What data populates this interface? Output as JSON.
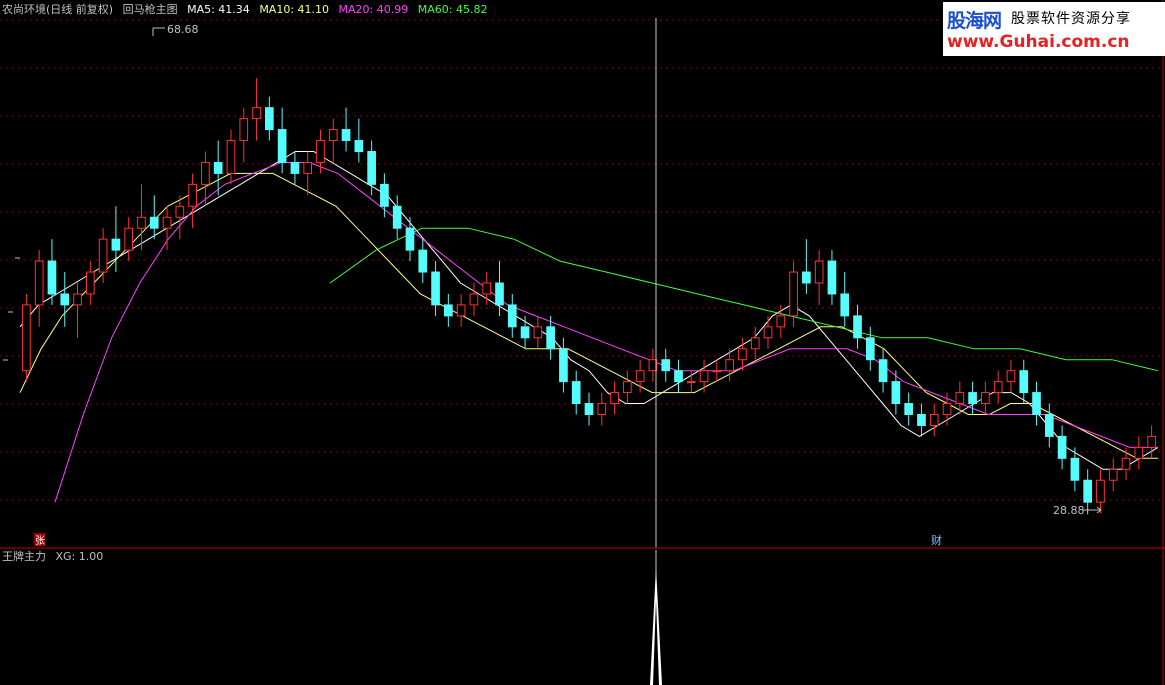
{
  "header": {
    "stock_name": "农尚环境(日线 前复权)",
    "formula_name": "回马枪主图",
    "ma5": "MA5: 41.34",
    "ma10": "MA10: 41.10",
    "ma20": "MA20: 40.99",
    "ma60": "MA60: 45.82",
    "colors": {
      "title": "#c0c0c0",
      "ma5": "#ffffff",
      "ma10": "#ffff80",
      "ma20": "#ff40ff",
      "ma60": "#40ff40"
    }
  },
  "logo": {
    "brand": "股海网",
    "slogan": "股票软件资源分享",
    "url": "www.Guhai.com.cn"
  },
  "indicator": {
    "name": "王牌主力",
    "value": "XG: 1.00"
  },
  "markers": {
    "high_label": "68.68",
    "low_label": "28.88",
    "badge_zhang": "张",
    "badge_cai": "财"
  },
  "chart_data": {
    "type": "candlestick",
    "price_range": [
      26,
      74
    ],
    "candles_ohlc": [
      [
        42,
        49,
        41,
        48
      ],
      [
        48,
        53,
        46,
        52
      ],
      [
        52,
        54,
        48,
        49
      ],
      [
        49,
        51,
        46,
        48
      ],
      [
        48,
        50,
        45,
        49
      ],
      [
        49,
        52,
        48,
        51
      ],
      [
        51,
        55,
        50,
        54
      ],
      [
        54,
        57,
        51,
        53
      ],
      [
        53,
        56,
        52,
        55
      ],
      [
        55,
        59,
        53,
        56
      ],
      [
        56,
        58,
        54,
        55
      ],
      [
        55,
        57,
        53,
        56
      ],
      [
        56,
        58,
        54,
        57
      ],
      [
        57,
        60,
        55,
        59
      ],
      [
        59,
        62,
        57,
        61
      ],
      [
        61,
        63,
        58,
        60
      ],
      [
        60,
        64,
        59,
        63
      ],
      [
        63,
        66,
        61,
        65
      ],
      [
        65,
        68.68,
        63,
        66
      ],
      [
        66,
        67,
        63,
        64
      ],
      [
        64,
        66,
        60,
        61
      ],
      [
        61,
        62,
        59,
        60
      ],
      [
        60,
        62,
        58,
        61
      ],
      [
        61,
        64,
        60,
        63
      ],
      [
        63,
        65,
        61,
        64
      ],
      [
        64,
        66,
        62,
        63
      ],
      [
        63,
        65,
        61,
        62
      ],
      [
        62,
        63,
        58,
        59
      ],
      [
        59,
        60,
        56,
        57
      ],
      [
        57,
        58,
        54,
        55
      ],
      [
        55,
        56,
        52,
        53
      ],
      [
        53,
        54,
        50,
        51
      ],
      [
        51,
        52,
        47,
        48
      ],
      [
        48,
        49,
        46,
        47
      ],
      [
        47,
        49,
        46,
        48
      ],
      [
        48,
        50,
        47,
        49
      ],
      [
        49,
        51,
        48,
        50
      ],
      [
        50,
        52,
        47,
        48
      ],
      [
        48,
        49,
        45,
        46
      ],
      [
        46,
        47,
        44,
        45
      ],
      [
        45,
        47,
        44,
        46
      ],
      [
        46,
        47,
        43,
        44
      ],
      [
        44,
        45,
        40,
        41
      ],
      [
        41,
        42,
        38,
        39
      ],
      [
        39,
        40,
        37,
        38
      ],
      [
        38,
        40,
        37,
        39
      ],
      [
        39,
        41,
        38,
        40
      ],
      [
        40,
        42,
        39,
        41
      ],
      [
        41,
        43,
        40,
        42
      ],
      [
        42,
        44,
        41,
        43
      ],
      [
        43,
        44,
        41,
        42
      ],
      [
        42,
        43,
        40,
        41
      ],
      [
        41,
        42,
        40,
        41
      ],
      [
        41,
        43,
        40,
        42
      ],
      [
        42,
        43,
        41,
        42
      ],
      [
        42,
        44,
        41,
        43
      ],
      [
        43,
        45,
        42,
        44
      ],
      [
        44,
        46,
        43,
        45
      ],
      [
        45,
        47,
        44,
        46
      ],
      [
        46,
        48,
        45,
        47
      ],
      [
        47,
        52,
        46,
        51
      ],
      [
        51,
        54,
        49,
        50
      ],
      [
        50,
        53,
        48,
        52
      ],
      [
        52,
        53,
        48,
        49
      ],
      [
        49,
        51,
        46,
        47
      ],
      [
        47,
        48,
        44,
        45
      ],
      [
        45,
        46,
        42,
        43
      ],
      [
        43,
        44,
        40,
        41
      ],
      [
        41,
        42,
        38,
        39
      ],
      [
        39,
        40,
        37,
        38
      ],
      [
        38,
        39,
        36,
        37
      ],
      [
        37,
        39,
        36,
        38
      ],
      [
        38,
        40,
        37,
        39
      ],
      [
        39,
        41,
        38,
        40
      ],
      [
        40,
        41,
        38,
        39
      ],
      [
        39,
        41,
        38,
        40
      ],
      [
        40,
        42,
        39,
        41
      ],
      [
        41,
        43,
        40,
        42
      ],
      [
        42,
        43,
        39,
        40
      ],
      [
        40,
        41,
        37,
        38
      ],
      [
        38,
        39,
        35,
        36
      ],
      [
        36,
        37,
        33,
        34
      ],
      [
        34,
        35,
        31,
        32
      ],
      [
        32,
        33,
        28.88,
        30
      ],
      [
        30,
        33,
        29,
        32
      ],
      [
        32,
        34,
        31,
        33
      ],
      [
        33,
        35,
        32,
        34
      ],
      [
        34,
        36,
        33,
        35
      ],
      [
        35,
        37,
        34,
        36
      ]
    ],
    "ma5": [
      46,
      48,
      49,
      50,
      51,
      52,
      53,
      54,
      55,
      56,
      57,
      58,
      59,
      60,
      61,
      62,
      62,
      61,
      60,
      59,
      58,
      56,
      54,
      52,
      50,
      49,
      48,
      47,
      46,
      45,
      43,
      42,
      40,
      39,
      39,
      40,
      41,
      42,
      43,
      44,
      45,
      47,
      48,
      47,
      45,
      43,
      41,
      39,
      37,
      36,
      37,
      38,
      39,
      40,
      40,
      39,
      37,
      35,
      34,
      33,
      33,
      34,
      35
    ],
    "ma10": [
      40,
      44,
      47,
      49,
      51,
      53,
      55,
      57,
      58,
      59,
      60,
      60,
      60,
      59,
      58,
      57,
      55,
      53,
      51,
      49,
      48,
      47,
      46,
      45,
      44,
      44,
      44,
      43,
      42,
      41,
      40,
      40,
      40,
      41,
      42,
      43,
      44,
      45,
      46,
      46,
      45,
      44,
      42,
      40,
      39,
      38,
      38,
      39,
      39,
      38,
      37,
      36,
      35,
      34,
      34
    ],
    "ma20": [
      30,
      38,
      45,
      50,
      54,
      57,
      59,
      60,
      61,
      61,
      60,
      58,
      56,
      54,
      52,
      50,
      48,
      47,
      46,
      45,
      44,
      43,
      42,
      42,
      42,
      43,
      44,
      44,
      44,
      43,
      41,
      40,
      39,
      38,
      38,
      38,
      37,
      36,
      35,
      35
    ],
    "ma60": [
      50,
      53,
      55,
      55,
      54,
      52,
      51,
      50,
      49,
      48,
      47,
      46,
      45,
      45,
      44,
      44,
      43,
      43,
      42
    ]
  }
}
